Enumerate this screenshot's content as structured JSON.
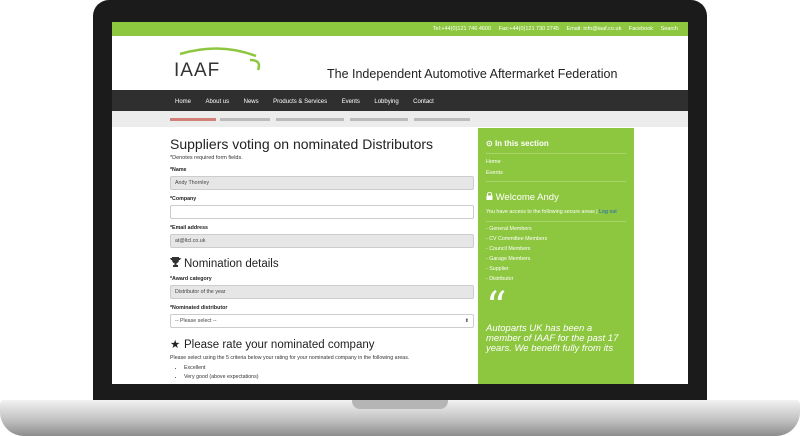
{
  "topbar": {
    "tel": "Tel:+44(0)121 746 4600",
    "fax": "Fax:+44(0)121 730 2745",
    "email": "Email: info@iaaf.co.uk",
    "facebook": "Facebook",
    "search": "Search"
  },
  "header": {
    "logo_text": "IAAF",
    "title": "The Independent Automotive Aftermarket Federation"
  },
  "nav": {
    "items": [
      "Home",
      "About us",
      "News",
      "Products & Services",
      "Events",
      "Lobbying",
      "Contact"
    ]
  },
  "form": {
    "title": "Suppliers voting on nominated Distributors",
    "required_note": "*Denotes required form fields.",
    "name_label": "*Name",
    "name_value": "Andy Thornley",
    "company_label": "*Company",
    "company_value": "",
    "email_label": "*Email address",
    "email_value": "at@ltcl.co.uk",
    "nomination_heading": "Nomination details",
    "award_label": "*Award category",
    "award_value": "Distributor of the year",
    "distributor_label": "*Nominated distributor",
    "distributor_value": "-- Please select --",
    "rate_heading": "Please rate your nominated company",
    "rate_instructions": "Please select using the 5 criteria below your rating for your nominated company in the following areas.",
    "criteria": [
      "Excellent",
      "Very good (above expectations)"
    ]
  },
  "sidebar": {
    "section_heading": "In this section",
    "section_links": [
      "Home",
      "Events"
    ],
    "welcome": "Welcome Andy",
    "access_note": "You have access to the following secure areas |",
    "logout": "Log out",
    "areas": [
      "- General Members",
      "- CV Committee Members",
      "- Council Members",
      "- Garage Members",
      "- Supplier",
      "- Distributor"
    ],
    "quote_mark": "“",
    "testimonial": "Autoparts UK has been a member of IAAF for the past 17 years. We benefit fully from its"
  },
  "colors": {
    "brand_green": "#8dc63f",
    "nav_dark": "#2f2f2f"
  }
}
